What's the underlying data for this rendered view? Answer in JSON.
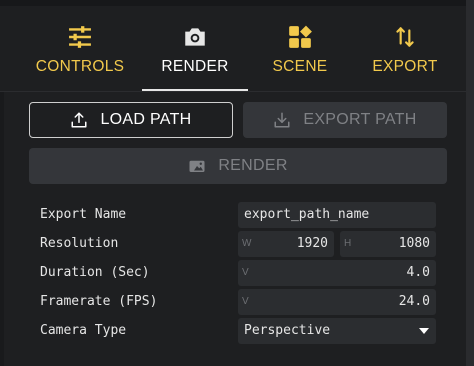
{
  "tabs": [
    {
      "label": "CONTROLS",
      "icon": "sliders-icon",
      "active": false
    },
    {
      "label": "RENDER",
      "icon": "camera-icon",
      "active": true
    },
    {
      "label": "SCENE",
      "icon": "shapes-icon",
      "active": false
    },
    {
      "label": "EXPORT",
      "icon": "swap-vertical-icon",
      "active": false
    }
  ],
  "buttons": {
    "load_path": "LOAD PATH",
    "export_path": "EXPORT PATH",
    "render": "RENDER"
  },
  "form": {
    "export_name": {
      "label": "Export Name",
      "value": "export_path_name"
    },
    "resolution": {
      "label": "Resolution",
      "w_prefix": "W",
      "w": "1920",
      "h_prefix": "H",
      "h": "1080"
    },
    "duration": {
      "label": "Duration (Sec)",
      "prefix": "V",
      "value": "4.0"
    },
    "framerate": {
      "label": "Framerate (FPS)",
      "prefix": "V",
      "value": "24.0"
    },
    "camera_type": {
      "label": "Camera Type",
      "value": "Perspective"
    }
  },
  "colors": {
    "accent": "#f2c94c",
    "background": "#1e1f21",
    "disabled": "#34363a"
  }
}
